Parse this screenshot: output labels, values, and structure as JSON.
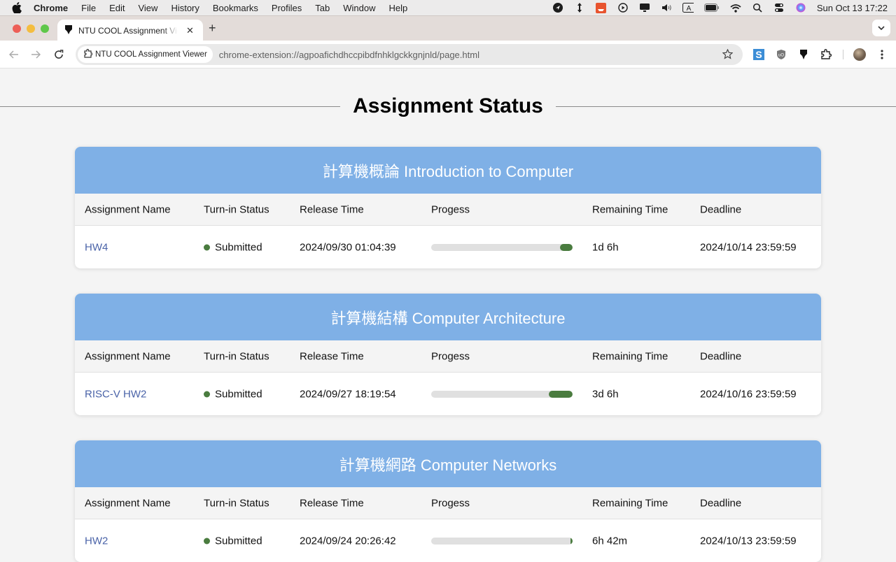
{
  "menubar": {
    "app_name": "Chrome",
    "items": [
      "File",
      "Edit",
      "View",
      "History",
      "Bookmarks",
      "Profiles",
      "Tab",
      "Window",
      "Help"
    ],
    "clock": "Sun Oct 13  17:22"
  },
  "browser": {
    "tab_title": "NTU COOL Assignment Viewer",
    "site_chip": "NTU COOL Assignment Viewer",
    "url": "chrome-extension://agpoafichdhccpibdfnhklgckkgnjnld/page.html"
  },
  "page": {
    "title": "Assignment Status",
    "columns": [
      "Assignment Name",
      "Turn-in Status",
      "Release Time",
      "Progess",
      "Remaining Time",
      "Deadline"
    ],
    "courses": [
      {
        "title": "計算機概論 Introduction to Computer",
        "assignments": [
          {
            "name": "HW4",
            "status": "Submitted",
            "release": "2024/09/30 01:04:39",
            "progress_remaining_pct": 9,
            "remaining": "1d 6h",
            "deadline": "2024/10/14 23:59:59"
          }
        ]
      },
      {
        "title": "計算機結構 Computer Architecture",
        "assignments": [
          {
            "name": "RISC-V HW2",
            "status": "Submitted",
            "release": "2024/09/27 18:19:54",
            "progress_remaining_pct": 17,
            "remaining": "3d 6h",
            "deadline": "2024/10/16 23:59:59"
          }
        ]
      },
      {
        "title": "計算機網路 Computer Networks",
        "assignments": [
          {
            "name": "HW2",
            "status": "Submitted",
            "release": "2024/09/24 20:26:42",
            "progress_remaining_pct": 1,
            "remaining": "6h 42m",
            "deadline": "2024/10/13 23:59:59"
          }
        ]
      }
    ]
  },
  "colors": {
    "course_header": "#7fb0e6",
    "status_submitted": "#4a7c3f",
    "link": "#4a63a8",
    "progress_track": "#e0e0e0"
  }
}
